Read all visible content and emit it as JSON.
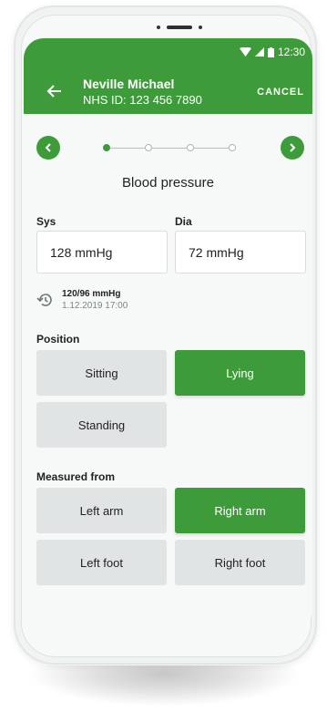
{
  "status": {
    "time": "12:30"
  },
  "header": {
    "name": "Neville Michael",
    "nhs_id": "NHS ID: 123 456 7890",
    "cancel": "CANCEL"
  },
  "stepper": {
    "total": 4,
    "current": 1
  },
  "title": "Blood pressure",
  "sys": {
    "label": "Sys",
    "value": "128 mmHg"
  },
  "dia": {
    "label": "Dia",
    "value": "72 mmHg"
  },
  "history": {
    "value": "120/96 mmHg",
    "time": "1.12.2019 17:00"
  },
  "position": {
    "label": "Position",
    "options": [
      "Sitting",
      "Lying",
      "Standing"
    ],
    "selected": "Lying"
  },
  "measured_from": {
    "label": "Measured from",
    "options": [
      "Left arm",
      "Right arm",
      "Left foot",
      "Right foot"
    ],
    "selected": "Right arm"
  },
  "colors": {
    "primary": "#3e9b3a",
    "option_bg": "#e1e4e4"
  }
}
